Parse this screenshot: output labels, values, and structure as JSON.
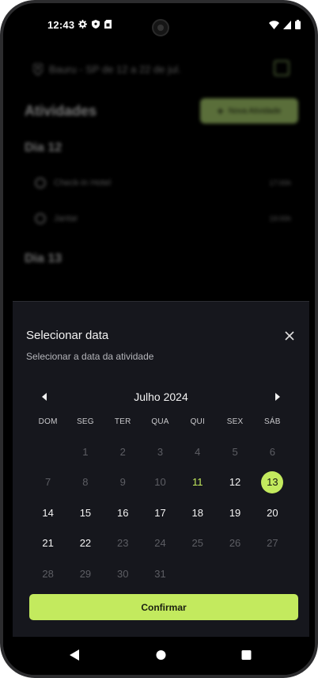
{
  "status_bar": {
    "time": "12:43"
  },
  "background": {
    "location": "Bauru - SP de 12 a 22 de jul.",
    "activities_title": "Atividades",
    "new_activity_label": "Nova Atividade",
    "day12_label": "Dia 12",
    "day13_label": "Dia 13",
    "items": [
      {
        "name": "Check-in Hotel",
        "time": "17:00h"
      },
      {
        "name": "Jantar",
        "time": "19:00h"
      }
    ]
  },
  "sheet": {
    "title": "Selecionar data",
    "subtitle": "Selecionar a data da atividade",
    "month": "Julho 2024",
    "weekdays": [
      "DOM",
      "SEG",
      "TER",
      "QUA",
      "QUI",
      "SEX",
      "SÁB"
    ],
    "days": [
      {
        "label": "",
        "state": "empty"
      },
      {
        "label": "1",
        "state": "disabled"
      },
      {
        "label": "2",
        "state": "disabled"
      },
      {
        "label": "3",
        "state": "disabled"
      },
      {
        "label": "4",
        "state": "disabled"
      },
      {
        "label": "5",
        "state": "disabled"
      },
      {
        "label": "6",
        "state": "disabled"
      },
      {
        "label": "7",
        "state": "disabled"
      },
      {
        "label": "8",
        "state": "disabled"
      },
      {
        "label": "9",
        "state": "disabled"
      },
      {
        "label": "10",
        "state": "disabled"
      },
      {
        "label": "11",
        "state": "today"
      },
      {
        "label": "12",
        "state": "enabled"
      },
      {
        "label": "13",
        "state": "selected"
      },
      {
        "label": "14",
        "state": "enabled"
      },
      {
        "label": "15",
        "state": "enabled"
      },
      {
        "label": "16",
        "state": "enabled"
      },
      {
        "label": "17",
        "state": "enabled"
      },
      {
        "label": "18",
        "state": "enabled"
      },
      {
        "label": "19",
        "state": "enabled"
      },
      {
        "label": "20",
        "state": "enabled"
      },
      {
        "label": "21",
        "state": "enabled"
      },
      {
        "label": "22",
        "state": "enabled"
      },
      {
        "label": "23",
        "state": "disabled"
      },
      {
        "label": "24",
        "state": "disabled"
      },
      {
        "label": "25",
        "state": "disabled"
      },
      {
        "label": "26",
        "state": "disabled"
      },
      {
        "label": "27",
        "state": "disabled"
      },
      {
        "label": "28",
        "state": "disabled"
      },
      {
        "label": "29",
        "state": "disabled"
      },
      {
        "label": "30",
        "state": "disabled"
      },
      {
        "label": "31",
        "state": "disabled"
      }
    ],
    "confirm_label": "Confirmar"
  },
  "colors": {
    "accent": "#c3ea5e",
    "sheet_background": "#16171d",
    "disabled_text": "#5d5e64"
  },
  "icons": {
    "status_left": [
      "gear-icon",
      "shield-icon",
      "sim-card-icon"
    ],
    "status_right": [
      "wifi-icon",
      "signal-icon",
      "battery-icon"
    ],
    "sheet": [
      "close-icon",
      "chevron-left-icon",
      "chevron-right-icon"
    ],
    "nav": [
      "back-icon",
      "home-icon",
      "recents-icon"
    ]
  }
}
